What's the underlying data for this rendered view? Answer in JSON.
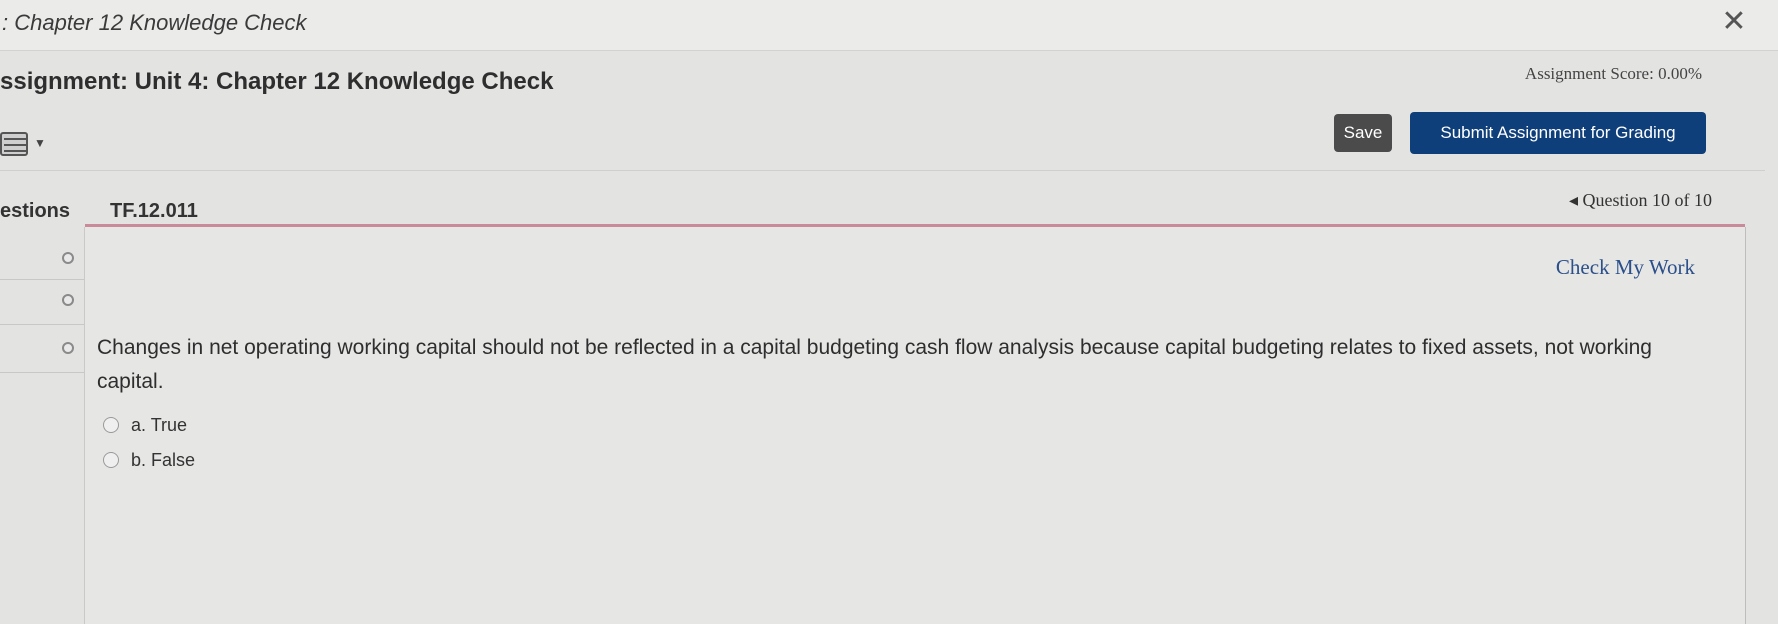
{
  "window": {
    "title": ": Chapter 12 Knowledge Check"
  },
  "assignment": {
    "title": "ssignment: Unit 4: Chapter 12 Knowledge Check",
    "score": "Assignment Score: 0.00%"
  },
  "toolbar": {
    "keyboard_icon": "keyboard-icon",
    "save_label": "Save",
    "submit_label": "Submit Assignment for Grading"
  },
  "question_header": {
    "questions_tab": "estions",
    "question_id": "TF.12.011",
    "nav": "◂ Question 10 of 10"
  },
  "question": {
    "check_link": "Check My Work",
    "text": "Changes in net operating working capital should not be reflected in a capital budgeting cash flow analysis because capital budgeting relates to fixed assets, not working capital.",
    "choices": [
      {
        "label": "a. True"
      },
      {
        "label": "b. False"
      }
    ]
  }
}
